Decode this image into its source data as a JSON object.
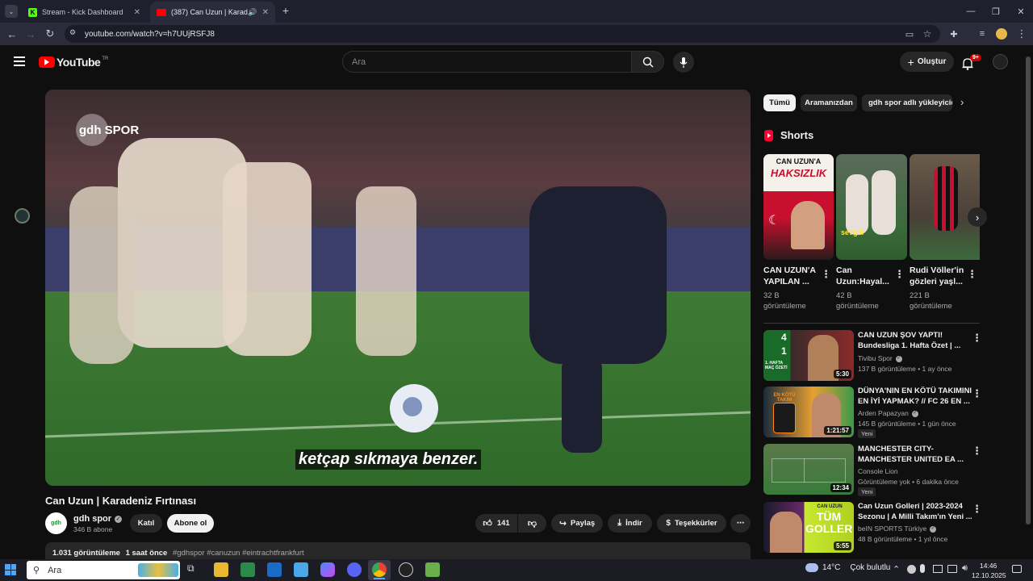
{
  "browser": {
    "tabs": [
      {
        "title": "Stream - Kick Dashboard"
      },
      {
        "title": "(387) Can Uzun | Karadeni"
      }
    ],
    "new_tab": "+",
    "url": "youtube.com/watch?v=h7UUjRSFJ8"
  },
  "youtube": {
    "logo": "YouTube",
    "region": "TR",
    "search_placeholder": "Ara",
    "create_label": "Oluştur",
    "notif_count": "9+"
  },
  "video": {
    "subtitle": "ketçap sıkmaya benzer.",
    "watermark": "gdh SPOR",
    "title": "Can Uzun | Karadeniz Fırtınası",
    "channel": "gdh spor",
    "subs": "346 B abone",
    "join": "Katıl",
    "subscribe": "Abone ol",
    "likes": "141",
    "share": "Paylaş",
    "download": "İndir",
    "thanks": "Teşekkürler",
    "views": "1.031 görüntüleme",
    "age": "1 saat önce",
    "hashtags": "#gdhspor #canuzun #eintrachtfrankfurt"
  },
  "filters": [
    "Tümü",
    "Aramanızdan",
    "gdh spor adlı yükleyicide"
  ],
  "shorts": {
    "header": "Shorts",
    "items": [
      {
        "title1": "CAN UZUN'A",
        "title2": "YAPILAN ...",
        "views1": "32 B",
        "views2": "görüntüleme",
        "thumb_text1": "CAN UZUN'A",
        "thumb_text2": "HAKSIZLIK"
      },
      {
        "title1": "Can",
        "title2": "Uzun:Hayal...",
        "views1": "42 B",
        "views2": "görüntüleme",
        "thumb_text1": "sevgili",
        "thumb_text2": ""
      },
      {
        "title1": "Rudi Völler'in",
        "title2": "gözleri yaşl...",
        "views1": "221 B",
        "views2": "görüntüleme",
        "thumb_text1": "",
        "thumb_text2": ""
      }
    ]
  },
  "recommended": [
    {
      "title1": "CAN UZUN ŞOV YAPTI!",
      "title2": "Bundesliga 1. Hafta Özet | ...",
      "channel": "Tivibu Spor",
      "verified": true,
      "stats": "137 B görüntüleme • 1 ay önce",
      "duration": "5:30",
      "badge": ""
    },
    {
      "title1": "DÜNYA'NIN EN KÖTÜ TAKIMINI",
      "title2": "EN İYİ YAPMAK? // FC 26 EN ...",
      "channel": "Arden Papazyan",
      "verified": true,
      "stats": "145 B görüntüleme • 1 gün önce",
      "duration": "1:21:57",
      "badge": "Yeni"
    },
    {
      "title1": "MANCHESTER CITY-",
      "title2": "MANCHESTER UNITED EA ...",
      "channel": "Console Lion",
      "verified": false,
      "stats": "Görüntüleme yok • 6 dakika önce",
      "duration": "12:34",
      "badge": "Yeni"
    },
    {
      "title1": "Can Uzun Golleri | 2023-2024",
      "title2": "Sezonu | A Milli Takım'ın Yeni ...",
      "channel": "beIN SPORTS Türkiye",
      "verified": true,
      "stats": "48 B görüntüleme • 1 yıl önce",
      "duration": "5:55",
      "badge": ""
    }
  ],
  "thumb_texts": {
    "t1_score1": "4",
    "t1_score2": "1",
    "t1_caption": "1. HAFTA MAÇ ÖZETİ",
    "t2_caption": "EN KÖTÜ TAKIM",
    "t4_caption1": "CAN UZUN",
    "t4_caption2": "TÜM GOLLER"
  },
  "taskbar": {
    "search": "Ara",
    "temp": "14°C",
    "weather": "Çok bulutlu",
    "time": "14:46",
    "date": "12.10.2025"
  }
}
